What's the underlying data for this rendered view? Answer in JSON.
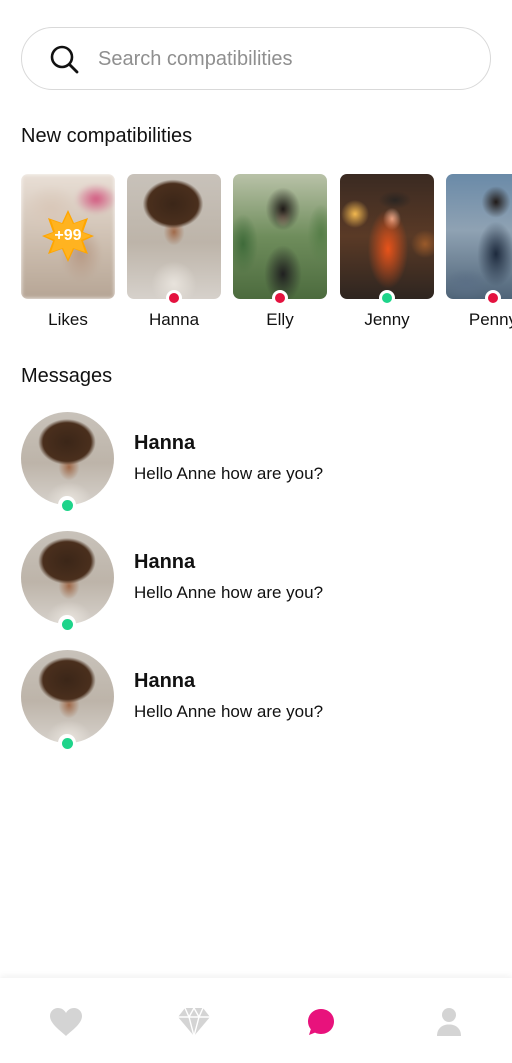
{
  "search": {
    "placeholder": "Search compatibilities",
    "icon": "search-icon"
  },
  "sections": {
    "new_compatibilities": "New compatibilities",
    "messages": "Messages"
  },
  "compatibilities": [
    {
      "name": "Likes",
      "badge": "+99",
      "blurred": true
    },
    {
      "name": "Hanna",
      "status": "offline"
    },
    {
      "name": "Elly",
      "status": "offline"
    },
    {
      "name": "Jenny",
      "status": "online"
    },
    {
      "name": "Penny",
      "status": "offline"
    }
  ],
  "messages": [
    {
      "sender": "Hanna",
      "preview": "Hello Anne how are you?",
      "status": "online"
    },
    {
      "sender": "Hanna",
      "preview": "Hello Anne how are you?",
      "status": "online"
    },
    {
      "sender": "Hanna",
      "preview": "Hello Anne how are you?",
      "status": "online"
    }
  ],
  "nav": {
    "items": [
      "heart-icon",
      "diamond-icon",
      "chat-icon",
      "profile-icon"
    ],
    "active": "chat-icon"
  },
  "colors": {
    "online": "#1ed48a",
    "offline": "#e4123f",
    "badge": "#ffa600",
    "accent": "#e8127c",
    "nav_inactive": "#d4d4d4"
  }
}
